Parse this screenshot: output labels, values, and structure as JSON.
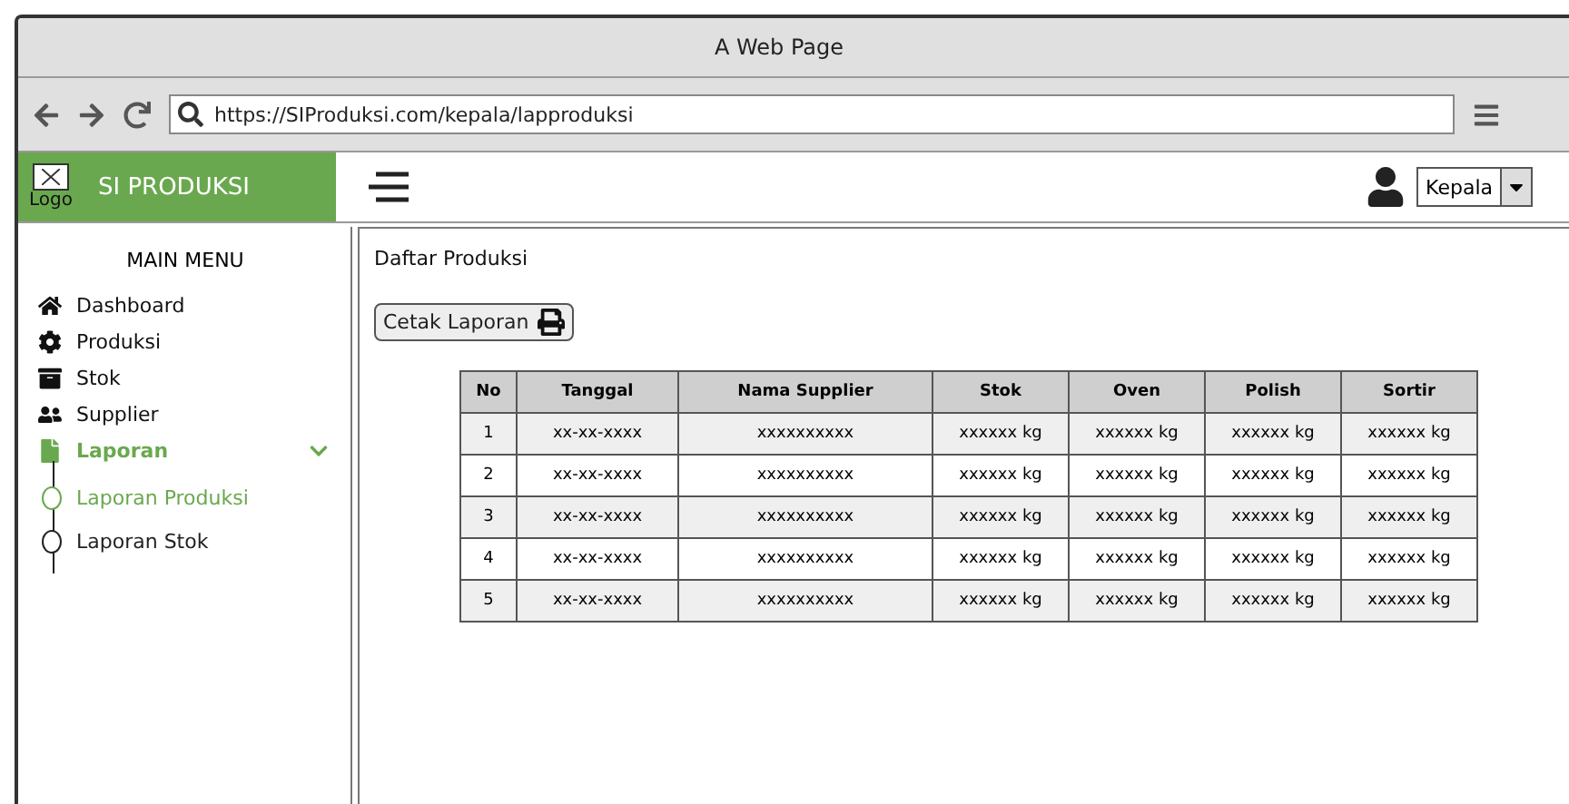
{
  "window": {
    "title": "A Web Page"
  },
  "browser": {
    "url": "https://SIProduksi.com/kepala/lapproduksi"
  },
  "header": {
    "logo_label": "Logo",
    "app_name": "SI PRODUKSI",
    "user": {
      "role": "Kepala"
    }
  },
  "sidebar": {
    "title": "MAIN MENU",
    "items": [
      {
        "label": "Dashboard",
        "selected": false
      },
      {
        "label": "Produksi",
        "selected": false
      },
      {
        "label": "Stok",
        "selected": false
      },
      {
        "label": "Supplier",
        "selected": false
      },
      {
        "label": "Laporan",
        "selected": true,
        "expanded": true,
        "children": [
          {
            "label": "Laporan Produksi",
            "selected": true
          },
          {
            "label": "Laporan Stok",
            "selected": false
          }
        ]
      }
    ]
  },
  "content": {
    "title": "Daftar Produksi",
    "print_button": "Cetak Laporan",
    "table": {
      "columns": [
        "No",
        "Tanggal",
        "Nama Supplier",
        "Stok",
        "Oven",
        "Polish",
        "Sortir"
      ],
      "rows": [
        [
          "1",
          "xx-xx-xxxx",
          "xxxxxxxxxx",
          "xxxxxx kg",
          "xxxxxx kg",
          "xxxxxx kg",
          "xxxxxx kg"
        ],
        [
          "2",
          "xx-xx-xxxx",
          "xxxxxxxxxx",
          "xxxxxx kg",
          "xxxxxx kg",
          "xxxxxx kg",
          "xxxxxx kg"
        ],
        [
          "3",
          "xx-xx-xxxx",
          "xxxxxxxxxx",
          "xxxxxx kg",
          "xxxxxx kg",
          "xxxxxx kg",
          "xxxxxx kg"
        ],
        [
          "4",
          "xx-xx-xxxx",
          "xxxxxxxxxx",
          "xxxxxx kg",
          "xxxxxx kg",
          "xxxxxx kg",
          "xxxxxx kg"
        ],
        [
          "5",
          "xx-xx-xxxx",
          "xxxxxxxxxx",
          "xxxxxx kg",
          "xxxxxx kg",
          "xxxxxx kg",
          "xxxxxx kg"
        ]
      ]
    }
  }
}
